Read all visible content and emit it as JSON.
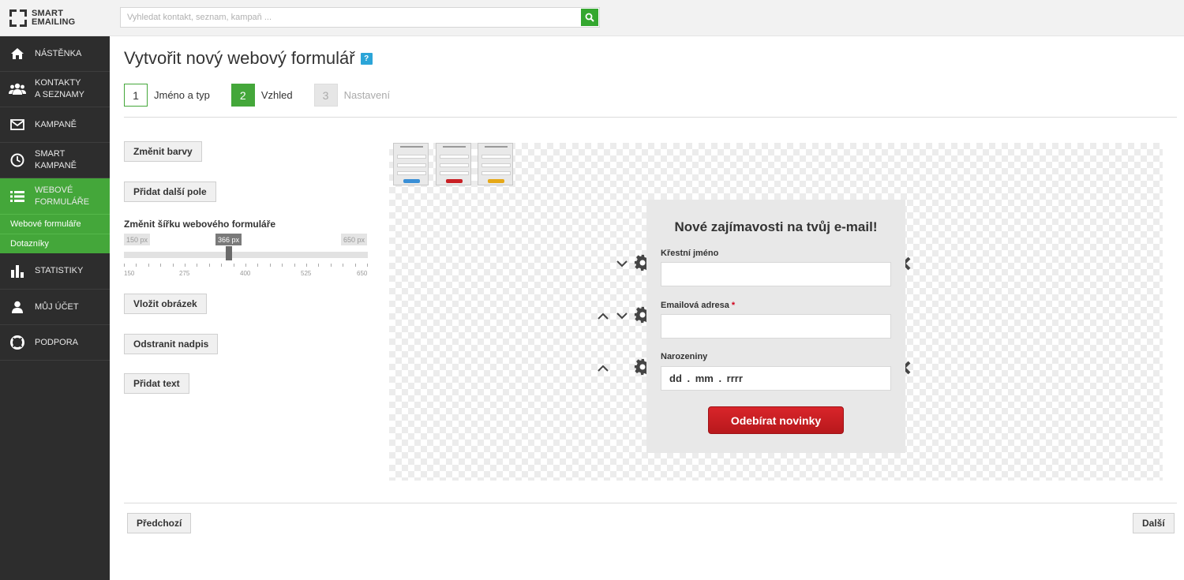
{
  "app": {
    "logo_line1": "SMART",
    "logo_line2": "EMAILING"
  },
  "search": {
    "placeholder": "Vyhledat kontakt, seznam, kampaň ...",
    "icon": "search-icon"
  },
  "sidebar": {
    "items": [
      {
        "label": "NÁSTĚNKA",
        "icon": "home-icon"
      },
      {
        "label_line1": "KONTAKTY",
        "label_line2": "A SEZNAMY",
        "icon": "users-icon"
      },
      {
        "label": "KAMPANĚ",
        "icon": "envelope-icon"
      },
      {
        "label_line1": "SMART",
        "label_line2": "KAMPANĚ",
        "icon": "clock-icon"
      },
      {
        "label_line1": "WEBOVÉ",
        "label_line2": "FORMULÁŘE",
        "icon": "list-icon",
        "active": true
      },
      {
        "label": "STATISTIKY",
        "icon": "bar-chart-icon"
      },
      {
        "label": "MŮJ ÚČET",
        "icon": "user-icon"
      },
      {
        "label": "PODPORA",
        "icon": "lifebuoy-icon"
      }
    ],
    "subitems": [
      "Webové formuláře",
      "Dotazníky"
    ]
  },
  "page": {
    "title": "Vytvořit nový webový formulář",
    "help": "?"
  },
  "steps": [
    {
      "number": "1",
      "label": "Jméno a typ",
      "state": "done"
    },
    {
      "number": "2",
      "label": "Vzhled",
      "state": "current"
    },
    {
      "number": "3",
      "label": "Nastavení",
      "state": "pending"
    }
  ],
  "tools": {
    "change_colors": "Změnit barvy",
    "add_field": "Přidat další pole",
    "width_label": "Změnit šířku webového formuláře",
    "width_min": "150 px",
    "width_current": "366 px",
    "width_max": "650 px",
    "width_value": 366,
    "width_range": [
      150,
      650
    ],
    "tick_labels": [
      "150",
      "275",
      "400",
      "525",
      "650"
    ],
    "insert_image": "Vložit obrázek",
    "remove_heading": "Odstranit nadpis",
    "add_text": "Přidat text"
  },
  "colors": {
    "accent": "#44a73a",
    "sidebar": "#2d2d2d",
    "help": "#2ba5d8",
    "button_red": "#c91f24"
  },
  "form": {
    "title": "Nové zajímavosti na tvůj e-mail!",
    "fields": [
      {
        "label": "Křestní jméno",
        "value": ""
      },
      {
        "label": "Emailová adresa",
        "required_mark": "*",
        "value": ""
      },
      {
        "label": "Narozeniny",
        "value": "dd . mm . rrrr"
      }
    ],
    "submit": "Odebírat novinky"
  },
  "footer": {
    "prev": "Předchozí",
    "next": "Další"
  }
}
